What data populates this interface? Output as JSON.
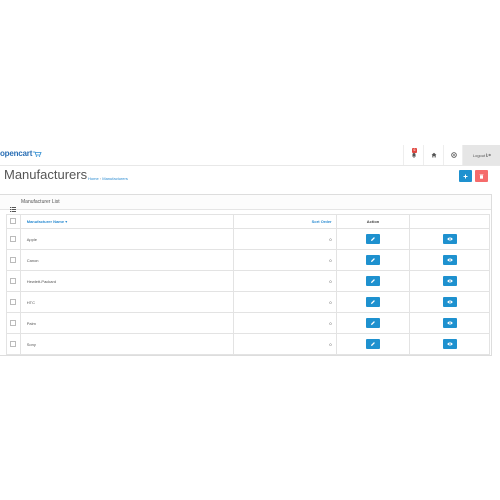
{
  "header": {
    "logo_text": "opencart",
    "notification_count": "6",
    "logout_label": "Logout"
  },
  "page": {
    "title": "Manufacturers",
    "breadcrumb": [
      "Home",
      "Manufacturers"
    ]
  },
  "panel": {
    "title": "Manufacturer List"
  },
  "table": {
    "columns": [
      "Manufacturer Name",
      "Sort Order",
      "Action"
    ],
    "rows": [
      {
        "name": "Apple",
        "sort_order": "0"
      },
      {
        "name": "Canon",
        "sort_order": "0"
      },
      {
        "name": "Hewlett-Packard",
        "sort_order": "0"
      },
      {
        "name": "HTC",
        "sort_order": "0"
      },
      {
        "name": "Palm",
        "sort_order": "0"
      },
      {
        "name": "Sony",
        "sort_order": "0"
      }
    ]
  },
  "colors": {
    "primary": "#1e91cf",
    "danger": "#f56b6b",
    "link": "#2a8bd1"
  }
}
